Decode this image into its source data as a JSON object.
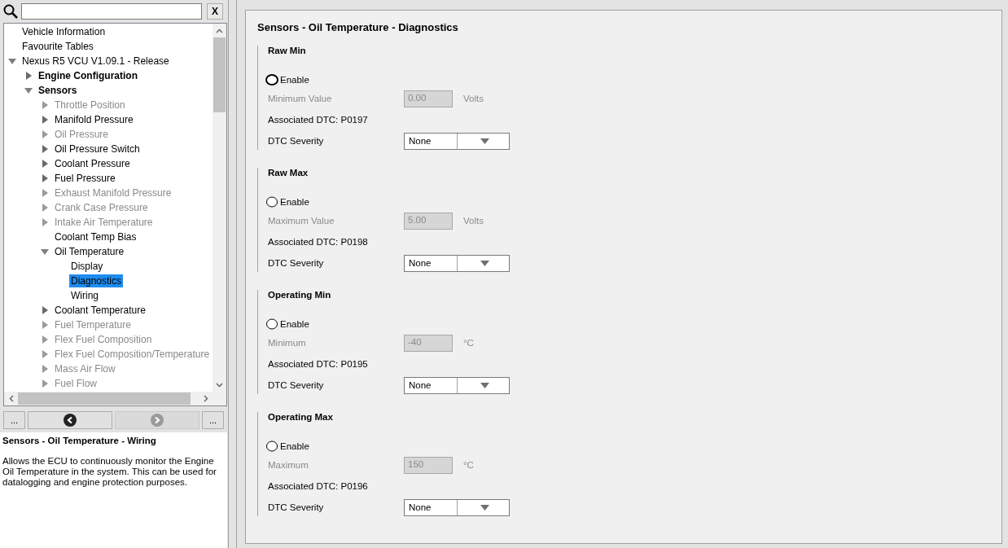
{
  "search": {
    "clear": "X"
  },
  "tree": [
    {
      "label": "Vehicle Information",
      "kind": "leaf",
      "bold": false,
      "disabled": false,
      "selected": false
    },
    {
      "label": "Favourite Tables",
      "kind": "leaf",
      "bold": false,
      "disabled": false,
      "selected": false
    },
    {
      "label": "Nexus R5 VCU V1.09.1 - Release",
      "kind": "branch",
      "expanded": true,
      "bold": false,
      "disabled": false,
      "selected": false,
      "children": [
        {
          "label": "Engine Configuration",
          "kind": "branch",
          "expanded": false,
          "bold": true,
          "disabled": false,
          "selected": false
        },
        {
          "label": "Sensors",
          "kind": "branch",
          "expanded": true,
          "bold": true,
          "disabled": false,
          "selected": false,
          "children": [
            {
              "label": "Throttle Position",
              "kind": "branch",
              "expanded": false,
              "bold": false,
              "disabled": true,
              "selected": false
            },
            {
              "label": "Manifold Pressure",
              "kind": "branch",
              "expanded": false,
              "bold": false,
              "disabled": false,
              "selected": false
            },
            {
              "label": "Oil Pressure",
              "kind": "branch",
              "expanded": false,
              "bold": false,
              "disabled": true,
              "selected": false
            },
            {
              "label": "Oil Pressure Switch",
              "kind": "branch",
              "expanded": false,
              "bold": false,
              "disabled": false,
              "selected": false
            },
            {
              "label": "Coolant Pressure",
              "kind": "branch",
              "expanded": false,
              "bold": false,
              "disabled": false,
              "selected": false
            },
            {
              "label": "Fuel Pressure",
              "kind": "branch",
              "expanded": false,
              "bold": false,
              "disabled": false,
              "selected": false
            },
            {
              "label": "Exhaust Manifold Pressure",
              "kind": "branch",
              "expanded": false,
              "bold": false,
              "disabled": true,
              "selected": false
            },
            {
              "label": "Crank Case Pressure",
              "kind": "branch",
              "expanded": false,
              "bold": false,
              "disabled": true,
              "selected": false
            },
            {
              "label": "Intake Air Temperature",
              "kind": "branch",
              "expanded": false,
              "bold": false,
              "disabled": true,
              "selected": false
            },
            {
              "label": "Coolant Temp Bias",
              "kind": "leaf",
              "bold": false,
              "disabled": false,
              "selected": false
            },
            {
              "label": "Oil Temperature",
              "kind": "branch",
              "expanded": true,
              "bold": false,
              "disabled": false,
              "selected": false,
              "children": [
                {
                  "label": "Display",
                  "kind": "leaf",
                  "bold": false,
                  "disabled": false,
                  "selected": false
                },
                {
                  "label": "Diagnostics",
                  "kind": "leaf",
                  "bold": false,
                  "disabled": false,
                  "selected": true
                },
                {
                  "label": "Wiring",
                  "kind": "leaf",
                  "bold": false,
                  "disabled": false,
                  "selected": false
                }
              ]
            },
            {
              "label": "Coolant Temperature",
              "kind": "branch",
              "expanded": false,
              "bold": false,
              "disabled": false,
              "selected": false
            },
            {
              "label": "Fuel Temperature",
              "kind": "branch",
              "expanded": false,
              "bold": false,
              "disabled": true,
              "selected": false
            },
            {
              "label": "Flex Fuel Composition",
              "kind": "branch",
              "expanded": false,
              "bold": false,
              "disabled": true,
              "selected": false
            },
            {
              "label": "Flex Fuel Composition/Temperature",
              "kind": "branch",
              "expanded": false,
              "bold": false,
              "disabled": true,
              "selected": false
            },
            {
              "label": "Mass Air Flow",
              "kind": "branch",
              "expanded": false,
              "bold": false,
              "disabled": true,
              "selected": false
            },
            {
              "label": "Fuel Flow",
              "kind": "branch",
              "expanded": false,
              "bold": false,
              "disabled": true,
              "selected": false
            }
          ]
        }
      ]
    }
  ],
  "nav_buttons": [
    {
      "kind": "more",
      "label": "...",
      "disabled": false
    },
    {
      "kind": "back",
      "disabled": false
    },
    {
      "kind": "forward",
      "disabled": true
    },
    {
      "kind": "more",
      "label": "...",
      "disabled": false
    }
  ],
  "description": {
    "title": "Sensors - Oil Temperature - Wiring",
    "text": "Allows the ECU to continuously monitor the Engine Oil Temperature in the system. This can be used for datalogging and engine protection purposes."
  },
  "page": {
    "title": "Sensors - Oil Temperature - Diagnostics",
    "sections": [
      {
        "title": "Raw Min",
        "enable": {
          "label": "Enable",
          "checked": false,
          "focused": true
        },
        "value_label": "Minimum Value",
        "value": "0.00",
        "value_disabled": true,
        "unit": "Volts",
        "dtc": "Associated DTC: P0197",
        "severity_label": "DTC Severity",
        "severity": "None"
      },
      {
        "title": "Raw Max",
        "enable": {
          "label": "Enable",
          "checked": false,
          "focused": false
        },
        "value_label": "Maximum Value",
        "value": "5.00",
        "value_disabled": true,
        "unit": "Volts",
        "dtc": "Associated DTC: P0198",
        "severity_label": "DTC Severity",
        "severity": "None"
      },
      {
        "title": "Operating Min",
        "enable": {
          "label": "Enable",
          "checked": false,
          "focused": false
        },
        "value_label": "Minimum",
        "value": "-40",
        "value_disabled": true,
        "unit": "°C",
        "dtc": "Associated DTC: P0195",
        "severity_label": "DTC Severity",
        "severity": "None"
      },
      {
        "title": "Operating Max",
        "enable": {
          "label": "Enable",
          "checked": false,
          "focused": false
        },
        "value_label": "Maximum",
        "value": "150",
        "value_disabled": true,
        "unit": "°C",
        "dtc": "Associated DTC: P0196",
        "severity_label": "DTC Severity",
        "severity": "None"
      }
    ]
  }
}
